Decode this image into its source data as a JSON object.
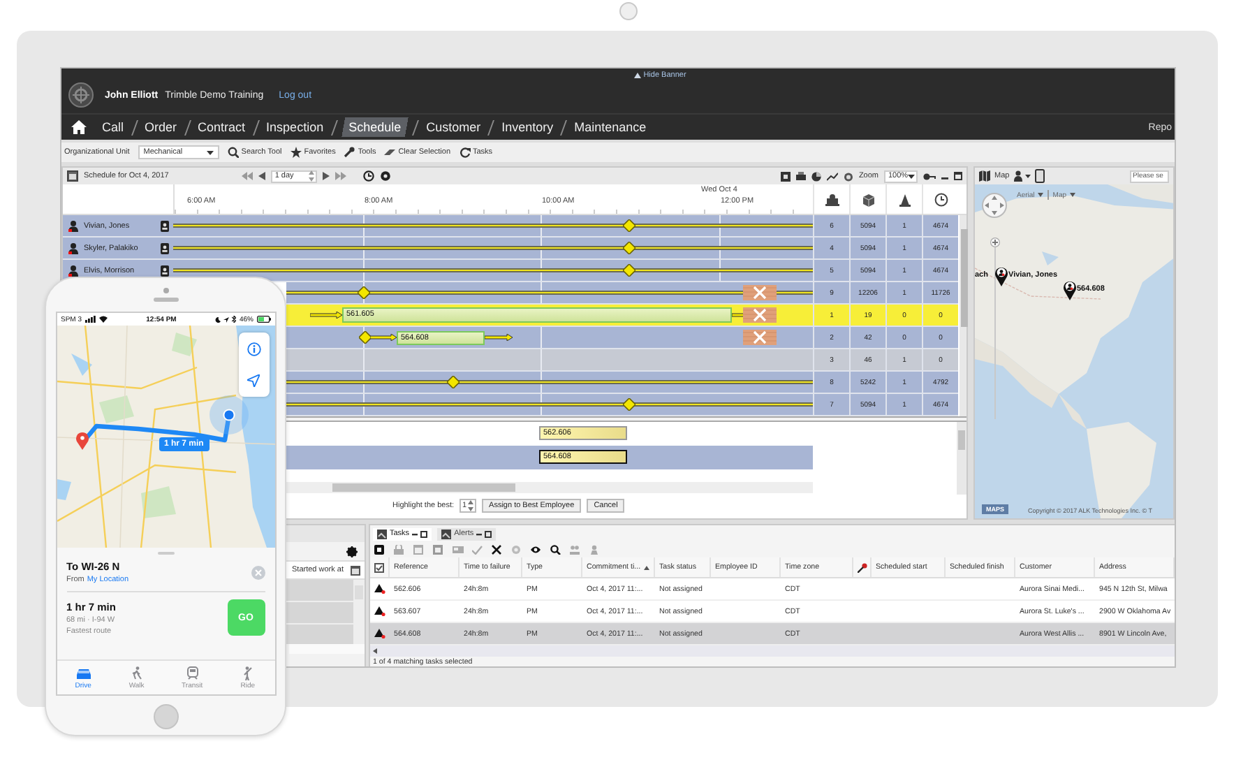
{
  "tablet": {
    "banner": {
      "user": "John Elliott",
      "company": "Trimble Demo Training",
      "logout": "Log out",
      "hide_banner": "Hide Banner"
    },
    "nav": [
      {
        "label": "Call",
        "selected": false
      },
      {
        "label": "Order",
        "selected": false
      },
      {
        "label": "Contract",
        "selected": false
      },
      {
        "label": "Inspection",
        "selected": false
      },
      {
        "label": "Schedule",
        "selected": true
      },
      {
        "label": "Customer",
        "selected": false
      },
      {
        "label": "Inventory",
        "selected": false
      },
      {
        "label": "Maintenance",
        "selected": false
      }
    ],
    "nav_right": "Repo",
    "toolbar": {
      "org_label": "Organizational Unit",
      "org_value": "Mechanical",
      "buttons": [
        "Search Tool",
        "Favorites",
        "Tools",
        "Clear Selection",
        "Tasks"
      ]
    },
    "schedule": {
      "title": "Schedule for Oct 4, 2017",
      "range": "1 day",
      "zoom_label": "Zoom",
      "zoom_value": "100%",
      "date_label": "Wed Oct 4",
      "time_labels": [
        "6:00 AM",
        "8:00 AM",
        "10:00 AM",
        "12:00 PM"
      ],
      "rows": [
        {
          "name": "Vivian, Jones",
          "selected": false,
          "stats": [
            "6",
            "5094",
            "1",
            "4674"
          ]
        },
        {
          "name": "Skyler, Palakiko",
          "selected": false,
          "stats": [
            "4",
            "5094",
            "1",
            "4674"
          ]
        },
        {
          "name": "Elvis, Morrison",
          "selected": false,
          "stats": [
            "5",
            "5094",
            "1",
            "4674"
          ]
        },
        {
          "selected": false,
          "stats": [
            "9",
            "12206",
            "1",
            "11726"
          ]
        },
        {
          "selected": true,
          "bar_label": "561.605",
          "stats": [
            "1",
            "19",
            "0",
            "0"
          ]
        },
        {
          "selected": false,
          "bar_label": "564.608",
          "stats": [
            "2",
            "42",
            "0",
            "0"
          ]
        },
        {
          "selected": false,
          "stats": [
            "3",
            "46",
            "1",
            "0"
          ]
        },
        {
          "selected": false,
          "stats": [
            "8",
            "5242",
            "1",
            "4792"
          ]
        },
        {
          "selected": false,
          "stats": [
            "7",
            "5094",
            "1",
            "4674"
          ]
        }
      ],
      "proposals": [
        {
          "label": "562.606",
          "selected": false
        },
        {
          "label": "564.608",
          "selected": true
        }
      ],
      "highlight_label": "Highlight the best:",
      "highlight_value": "1",
      "assign": "Assign to Best Employee",
      "cancel": "Cancel"
    },
    "map": {
      "title": "Map",
      "search_placeholder": "Please se",
      "layers": [
        "Aerial",
        "Map"
      ],
      "cut_label": "ach",
      "pins": [
        {
          "label": "Vivian, Jones"
        },
        {
          "label": "564.608"
        }
      ],
      "logo": "MAPS",
      "copyright": "Copyright © 2017 ALK Technologies Inc. © T"
    },
    "left_panel": {
      "column": "Started work at"
    },
    "tasks": {
      "tabs": [
        {
          "label": "Tasks",
          "selected": true
        },
        {
          "label": "Alerts",
          "selected": false
        }
      ],
      "columns": [
        {
          "kind": "check"
        },
        {
          "kind": "text",
          "label": "Reference",
          "sorted": false
        },
        {
          "kind": "text",
          "label": "Time to failure",
          "sorted": false
        },
        {
          "kind": "text",
          "label": "Type",
          "sorted": false
        },
        {
          "kind": "text",
          "label": "Commitment ti...",
          "sorted": true
        },
        {
          "kind": "text",
          "label": "Task status",
          "sorted": false
        },
        {
          "kind": "text",
          "label": "Employee ID",
          "sorted": false
        },
        {
          "kind": "text",
          "label": "Time zone",
          "sorted": false
        },
        {
          "kind": "key"
        },
        {
          "kind": "text",
          "label": "Scheduled start",
          "sorted": false
        },
        {
          "kind": "text",
          "label": "Scheduled finish",
          "sorted": false
        },
        {
          "kind": "text",
          "label": "Customer",
          "sorted": false
        },
        {
          "kind": "text",
          "label": "Address",
          "sorted": false
        }
      ],
      "rows": [
        {
          "selected": false,
          "cells": [
            null,
            "562.606",
            "24h:8m",
            "PM",
            "Oct 4, 2017 11:...",
            "Not assigned",
            null,
            "CDT",
            null,
            null,
            null,
            "Aurora Sinai Medi...",
            "945 N 12th St, Milwa"
          ]
        },
        {
          "selected": false,
          "cells": [
            null,
            "563.607",
            "24h:8m",
            "PM",
            "Oct 4, 2017 11:...",
            "Not assigned",
            null,
            "CDT",
            null,
            null,
            null,
            "Aurora St. Luke's ...",
            "2900 W Oklahoma Av"
          ]
        },
        {
          "selected": true,
          "cells": [
            null,
            "564.608",
            "24h:8m",
            "PM",
            "Oct 4, 2017 11:...",
            "Not assigned",
            null,
            "CDT",
            null,
            null,
            null,
            "Aurora West Allis ...",
            "8901 W Lincoln Ave,"
          ]
        }
      ],
      "footer": "1 of 4 matching tasks selected"
    }
  },
  "phone": {
    "status": {
      "carrier": "SPM 3",
      "time": "12:54 PM",
      "battery": "46%"
    },
    "route_callout": "1 hr 7 min",
    "sheet": {
      "title": "To WI-26 N",
      "from_label": "From",
      "from_link": "My Location",
      "duration": "1 hr 7 min",
      "distance": "68 mi · I-94 W",
      "note": "Fastest route",
      "go": "GO"
    },
    "tabs": [
      {
        "label": "Drive",
        "selected": true
      },
      {
        "label": "Walk",
        "selected": false
      },
      {
        "label": "Transit",
        "selected": false
      },
      {
        "label": "Ride",
        "selected": false
      }
    ]
  }
}
